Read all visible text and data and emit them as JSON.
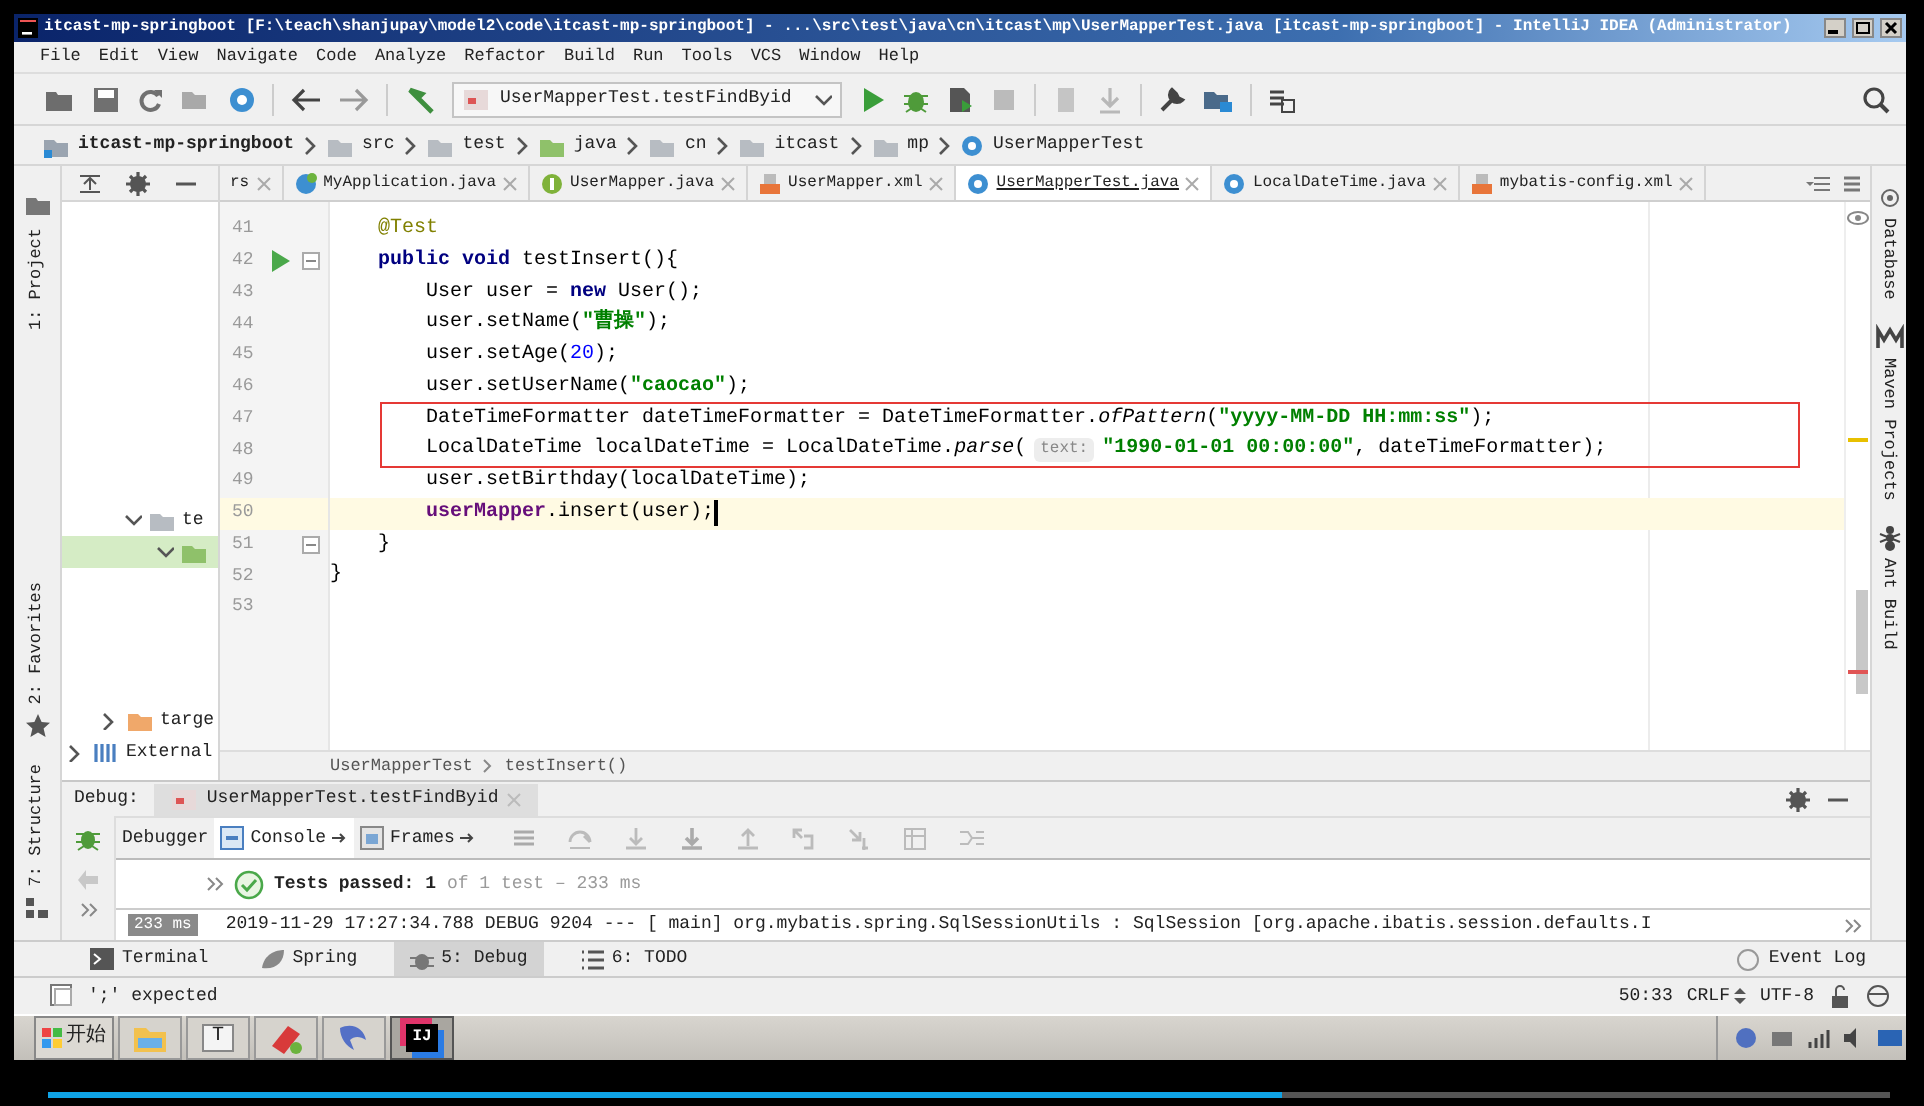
{
  "window": {
    "title": "itcast-mp-springboot [F:\\teach\\shanjupay\\model2\\code\\itcast-mp-springboot] - ...\\src\\test\\java\\cn\\itcast\\mp\\UserMapperTest.java [itcast-mp-springboot] - IntelliJ IDEA (Administrator)"
  },
  "menu": [
    "File",
    "Edit",
    "View",
    "Navigate",
    "Code",
    "Analyze",
    "Refactor",
    "Build",
    "Run",
    "Tools",
    "VCS",
    "Window",
    "Help"
  ],
  "toolbar": {
    "run_config": "UserMapperTest.testFindByid"
  },
  "breadcrumb": [
    {
      "label": "itcast-mp-springboot",
      "kind": "module"
    },
    {
      "label": "src",
      "kind": "folder"
    },
    {
      "label": "test",
      "kind": "folder"
    },
    {
      "label": "java",
      "kind": "source"
    },
    {
      "label": "cn",
      "kind": "folder"
    },
    {
      "label": "itcast",
      "kind": "folder"
    },
    {
      "label": "mp",
      "kind": "folder"
    },
    {
      "label": "UserMapperTest",
      "kind": "class"
    }
  ],
  "left_stripe": [
    {
      "label": "1: Project",
      "kind": "project"
    },
    {
      "label": "2: Favorites",
      "kind": "favorites"
    },
    {
      "label": "7: Structure",
      "kind": "structure"
    }
  ],
  "right_stripe": [
    {
      "label": "Database",
      "kind": "database"
    },
    {
      "label": "Maven Projects",
      "kind": "maven"
    },
    {
      "label": "Ant Build",
      "kind": "ant"
    }
  ],
  "project_tree": [
    {
      "label": "te",
      "kind": "folder",
      "expanded": true,
      "selected": false,
      "children": [
        {
          "kind": "source-folder",
          "expanded": true,
          "selected": true
        }
      ]
    },
    {
      "label": "targe",
      "kind": "excluded-folder",
      "expanded": false,
      "selected": false
    },
    {
      "label": "External",
      "kind": "library",
      "expanded": false,
      "selected": false
    }
  ],
  "editor_tabs": [
    {
      "label": "rs",
      "kind": "plain",
      "selected": false
    },
    {
      "label": "MyApplication.java",
      "kind": "spring-class",
      "selected": false
    },
    {
      "label": "UserMapper.java",
      "kind": "interface",
      "selected": false
    },
    {
      "label": "UserMapper.xml",
      "kind": "xml",
      "selected": false
    },
    {
      "label": "UserMapperTest.java",
      "kind": "class",
      "selected": true
    },
    {
      "label": "LocalDateTime.java",
      "kind": "class",
      "selected": false
    },
    {
      "label": "mybatis-config.xml",
      "kind": "xml",
      "selected": false
    }
  ],
  "code_lines": [
    {
      "kind": "line",
      "number": "41",
      "current": false,
      "run": false,
      "fold": false,
      "tokens": [
        {
          "kind": "annotation",
          "text": "    @Test"
        }
      ]
    },
    {
      "kind": "line",
      "number": "42",
      "current": false,
      "run": true,
      "fold": true,
      "tokens": [
        {
          "kind": "keyword",
          "text": "    public"
        },
        {
          "kind": "keyword",
          "text": " void"
        },
        {
          "kind": "plain",
          "text": " testInsert(){"
        }
      ]
    },
    {
      "kind": "line",
      "number": "43",
      "current": false,
      "run": false,
      "fold": false,
      "tokens": [
        {
          "kind": "plain",
          "text": "        User user = "
        },
        {
          "kind": "keyword",
          "text": "new"
        },
        {
          "kind": "plain",
          "text": " User();"
        }
      ]
    },
    {
      "kind": "line",
      "number": "44",
      "current": false,
      "run": false,
      "fold": false,
      "tokens": [
        {
          "kind": "plain",
          "text": "        user.setName("
        },
        {
          "kind": "string",
          "text": "\"曹操\""
        },
        {
          "kind": "plain",
          "text": ");"
        }
      ]
    },
    {
      "kind": "line",
      "number": "45",
      "current": false,
      "run": false,
      "fold": false,
      "tokens": [
        {
          "kind": "plain",
          "text": "        user.setAge("
        },
        {
          "kind": "number",
          "text": "20"
        },
        {
          "kind": "plain",
          "text": ");"
        }
      ]
    },
    {
      "kind": "line",
      "number": "46",
      "current": false,
      "run": false,
      "fold": false,
      "tokens": [
        {
          "kind": "plain",
          "text": "        user.setUserName("
        },
        {
          "kind": "string",
          "text": "\"caocao\""
        },
        {
          "kind": "plain",
          "text": ");"
        }
      ]
    },
    {
      "kind": "box",
      "lines": [
        {
          "number": "47",
          "current": false,
          "run": false,
          "fold": false,
          "tokens": [
            {
              "kind": "plain",
              "text": "        DateTimeFormatter dateTimeFormatter = DateTimeFormatter."
            },
            {
              "kind": "static",
              "text": "ofPattern"
            },
            {
              "kind": "plain",
              "text": "("
            },
            {
              "kind": "string",
              "text": "\"yyyy-MM-DD HH:mm:ss\""
            },
            {
              "kind": "plain",
              "text": ");"
            }
          ]
        },
        {
          "number": "48",
          "current": false,
          "run": false,
          "fold": false,
          "tokens": [
            {
              "kind": "plain",
              "text": "        LocalDateTime localDateTime = LocalDateTime."
            },
            {
              "kind": "static",
              "text": "parse"
            },
            {
              "kind": "plain",
              "text": "("
            },
            {
              "kind": "hint",
              "text": "text:"
            },
            {
              "kind": "string",
              "text": "\"1990-01-01 00:00:00\""
            },
            {
              "kind": "plain",
              "text": ", dateTimeFormatter);"
            }
          ]
        }
      ]
    },
    {
      "kind": "line",
      "number": "49",
      "current": false,
      "run": false,
      "fold": false,
      "tokens": [
        {
          "kind": "plain",
          "text": "        user.setBirthday(localDateTime);"
        }
      ]
    },
    {
      "kind": "line",
      "number": "50",
      "current": true,
      "run": false,
      "fold": false,
      "tokens": [
        {
          "kind": "field",
          "text": "        userMapper"
        },
        {
          "kind": "plain",
          "text": ".insert(user);"
        }
      ]
    },
    {
      "kind": "line",
      "number": "51",
      "current": false,
      "run": false,
      "fold": true,
      "tokens": [
        {
          "kind": "plain",
          "text": "    }"
        }
      ]
    },
    {
      "kind": "line",
      "number": "52",
      "current": false,
      "run": false,
      "fold": false,
      "tokens": [
        {
          "kind": "plain",
          "text": "}"
        }
      ]
    },
    {
      "kind": "line",
      "number": "53",
      "current": false,
      "run": false,
      "fold": false
    }
  ],
  "editor_breadcrumb": [
    "UserMapperTest",
    "testInsert()"
  ],
  "debug": {
    "label": "Debug:",
    "session_tab": "UserMapperTest.testFindByid",
    "tabs": [
      {
        "label": "Debugger",
        "selected": false
      },
      {
        "label": "Console",
        "selected": true
      },
      {
        "label": "Frames",
        "selected": false
      }
    ],
    "test_status": {
      "label": "Tests passed:",
      "count": "1",
      "detail": "of 1 test – 233 ms"
    },
    "console": [
      {
        "time": "233 ms",
        "text": "2019-11-29 17:27:34.788 DEBUG 9204 --- [           main] org.mybatis.spring.SqlSessionUtils       : SqlSession [org.apache.ibatis.session.defaults.I"
      }
    ]
  },
  "bottom_tabs": [
    {
      "label": "Terminal",
      "kind": "terminal",
      "selected": false
    },
    {
      "label": "Spring",
      "kind": "spring",
      "selected": false
    },
    {
      "label": "5: Debug",
      "kind": "debug",
      "selected": true
    },
    {
      "label": "6: TODO",
      "kind": "todo",
      "selected": false
    }
  ],
  "event_log": "Event Log",
  "status_bar": {
    "message": "';' expected",
    "position": "50:33",
    "line_separator": "CRLF",
    "encoding": "UTF-8"
  },
  "taskbar": {
    "start": "开始",
    "apps": [
      {
        "kind": "explorer",
        "selected": false
      },
      {
        "kind": "letter",
        "label": "T",
        "selected": false
      },
      {
        "kind": "eraser",
        "selected": false
      },
      {
        "kind": "dolphin",
        "selected": false
      },
      {
        "kind": "intellij",
        "label": "IJ",
        "selected": true
      }
    ]
  },
  "player": {
    "level": 0.67
  }
}
